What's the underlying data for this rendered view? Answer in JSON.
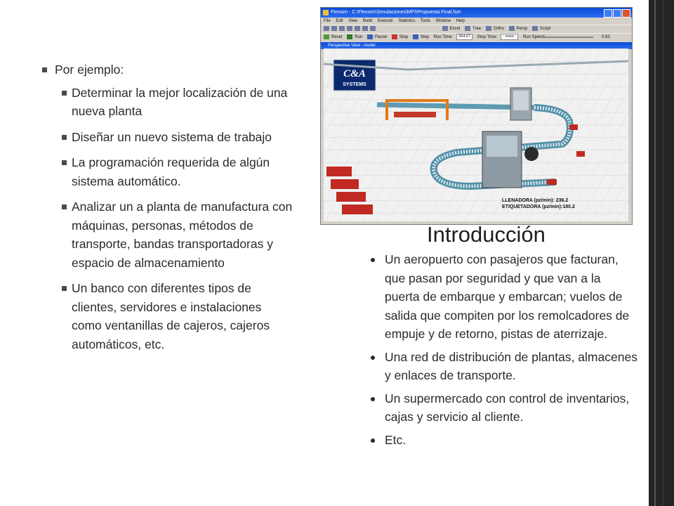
{
  "left_list": {
    "header": "Por ejemplo:",
    "items": [
      "Determinar la mejor localización de una nueva planta",
      "Diseñar un nuevo sistema de trabajo",
      "La programación requerida de algún sistema automático.",
      "Analizar un a planta de manufactura con máquinas, personas, métodos de transporte, bandas transportadoras y espacio de almacenamiento",
      "Un banco con diferentes tipos de clientes, servidores e instalaciones como ventanillas de cajeros, cajeros automáticos, etc."
    ]
  },
  "heading": "Introducción",
  "right_list": {
    "items": [
      "Un aeropuerto con pasajeros que facturan, que pasan por seguridad y que van a la puerta de embarque y embarcan; vuelos de salida que compiten por los remolcadores de empuje y de retorno, pistas de aterrizaje.",
      "Una red de distribución de plantas, almacenes y enlaces de transporte.",
      "Un supermercado con control de inventarios, cajas y servicio al cliente.",
      "Etc."
    ]
  },
  "app": {
    "title": "Flexsim - C:\\Flexsim\\Simulaciones\\MPI\\Propuesta Final.fsm",
    "menu": [
      "File",
      "Edit",
      "View",
      "Build",
      "Execute",
      "Statistics",
      "Tools",
      "Window",
      "Help"
    ],
    "toolbar": [
      "Excel",
      "Tree",
      "Ortho",
      "Persp",
      "Script"
    ],
    "controls": {
      "reset": "Reset",
      "run": "Run",
      "pause": "Pause",
      "stop": "Stop",
      "step": "Step",
      "run_time_label": "Run Time:",
      "run_time": "264.67",
      "stop_time_label": "Stop Time:",
      "stop_time": "- none -",
      "run_speed_label": "Run Speed:",
      "run_speed": "0.63"
    },
    "view_title": "Perspective View - model",
    "logo_line1": "C&A",
    "logo_line2": "SYSTEMS",
    "readout": [
      "LLENADORA (pz/min): 236.2",
      "ETIQUETADORA (pz/min):180.2"
    ]
  },
  "colors": {
    "frame": "#242424",
    "titlebar": "#0a4bd6",
    "conveyor": "#4f8fa8"
  }
}
